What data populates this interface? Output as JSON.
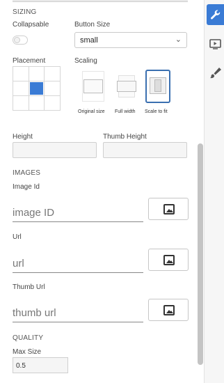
{
  "sizing": {
    "heading": "SIZING",
    "collapsable_label": "Collapsable",
    "button_size_label": "Button Size",
    "button_size_value": "small",
    "placement_label": "Placement",
    "scaling_label": "Scaling",
    "scaling_options": [
      "Original size",
      "Full width",
      "Scale to fit"
    ],
    "scaling_selected": "Scale to fit",
    "height_label": "Height",
    "thumb_height_label": "Thumb Height"
  },
  "images": {
    "heading": "IMAGES",
    "image_id_label": "Image Id",
    "image_id_placeholder": "image ID",
    "url_label": "Url",
    "url_placeholder": "url",
    "thumb_url_label": "Thumb Url",
    "thumb_url_placeholder": "thumb url"
  },
  "quality": {
    "heading": "QUALITY",
    "max_size_label": "Max Size",
    "max_size_value": "0.5"
  },
  "side_rail": {
    "active_tab": "wrench-icon",
    "tabs": [
      "wrench-icon",
      "play-icon",
      "brush-icon"
    ]
  },
  "colors": {
    "accent": "#3a7bd5",
    "selected_border": "#3a6fb0"
  }
}
